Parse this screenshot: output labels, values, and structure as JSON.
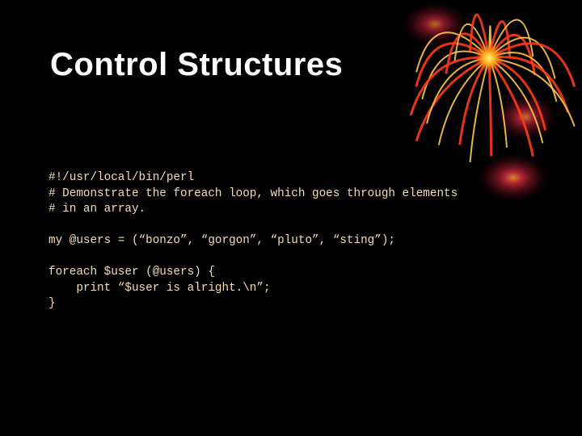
{
  "slide": {
    "title": "Control Structures",
    "code_lines": [
      "#!/usr/local/bin/perl",
      "# Demonstrate the foreach loop, which goes through elements",
      "# in an array.",
      "",
      "my @users = (“bonzo”, “gorgon”, “pluto”, “sting”);",
      "",
      "foreach $user (@users) {",
      "    print “$user is alright.\\n”;",
      "}"
    ],
    "decoration": "firework-icon",
    "colors": {
      "background": "#000000",
      "title": "#ffffff",
      "code": "#f5deb3",
      "firework_primary": "#ff3a1a",
      "firework_secondary": "#ffc84a"
    }
  }
}
